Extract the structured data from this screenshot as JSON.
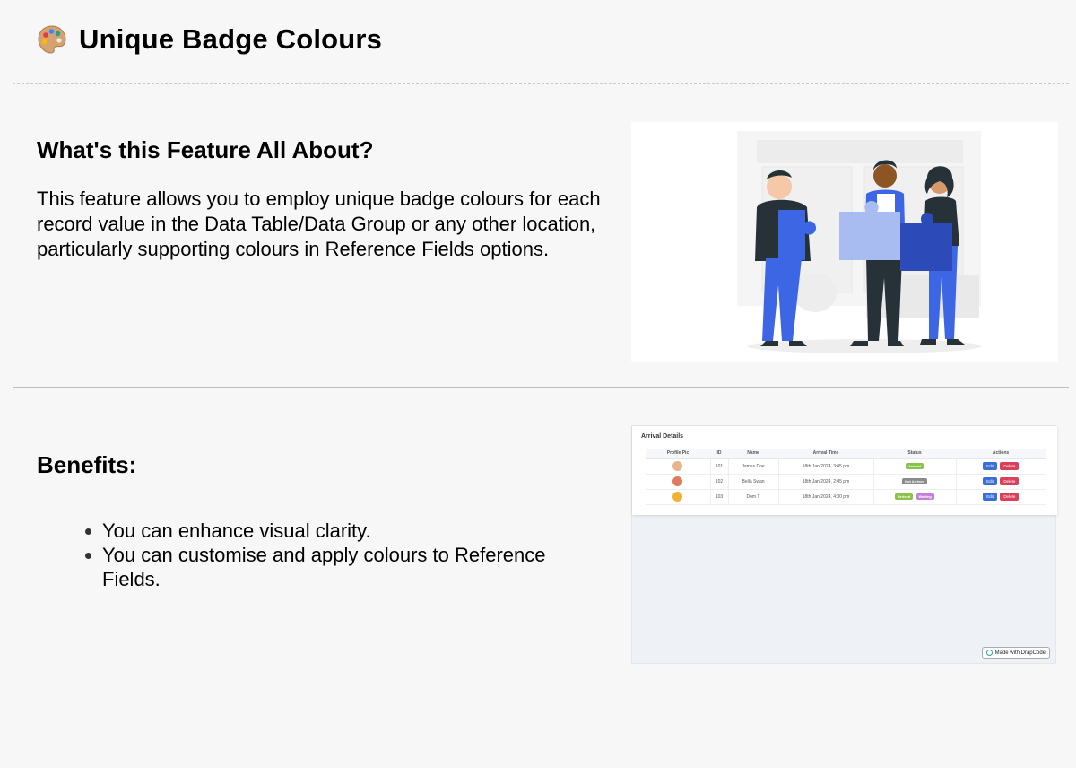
{
  "page": {
    "title": "Unique Badge Colours",
    "title_icon": "artist-palette-icon"
  },
  "feature": {
    "heading": "What's this Feature All About?",
    "body": "This feature allows you to employ unique badge colours for each record value in the Data Table/Data Group or any other location, particularly supporting colours in Reference Fields options.",
    "illustration_icon": "people-holding-puzzle-pieces-illustration"
  },
  "benefits": {
    "heading": "Benefits:",
    "items": [
      "You can enhance visual clarity.",
      "You can customise and apply colours to Reference Fields."
    ]
  },
  "screenshot": {
    "title": "Arrival Details",
    "columns": [
      "Profile Pic",
      "ID",
      "Name",
      "Arrival Time",
      "Status",
      "Actions"
    ],
    "rows": [
      {
        "id": "101",
        "name": "James Doe",
        "arrival_time": "18th Jan 2024, 3:45 pm",
        "statuses": [
          {
            "label": "Arrived",
            "color": "#8bc34a"
          }
        ],
        "avatar_color": "#e8b48a"
      },
      {
        "id": "102",
        "name": "Bella Swan",
        "arrival_time": "18th Jan 2024, 2:45 pm",
        "statuses": [
          {
            "label": "Not Arrived",
            "color": "#8a8a8a"
          }
        ],
        "avatar_color": "#e07a5f"
      },
      {
        "id": "103",
        "name": "Dom T",
        "arrival_time": "18th Jan 2024, 4:00 pm",
        "statuses": [
          {
            "label": "Arrived",
            "color": "#8bc34a"
          },
          {
            "label": "Waiting",
            "color": "#c47fd8"
          }
        ],
        "avatar_color": "#f2b135"
      }
    ],
    "actions": {
      "edit": "Edit",
      "delete": "Delete"
    },
    "made_with": "Made with DrapCode"
  }
}
